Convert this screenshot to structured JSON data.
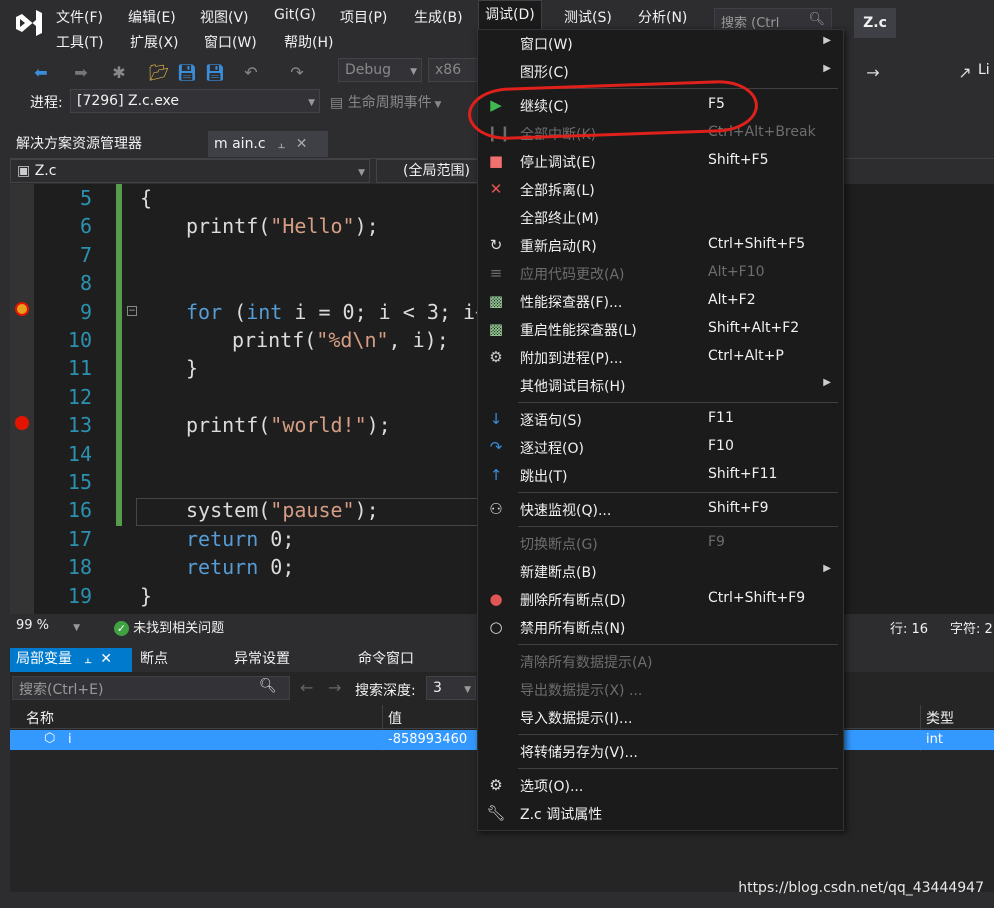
{
  "menubar": {
    "row1": [
      "文件(F)",
      "编辑(E)",
      "视图(V)",
      "Git(G)",
      "项目(P)",
      "生成(B)",
      "调试(D)",
      "测试(S)",
      "分析(N)"
    ],
    "row2": [
      "工具(T)",
      "扩展(X)",
      "窗口(W)",
      "帮助(H)"
    ],
    "search_placeholder": "搜索 (Ctrl",
    "solution_badge": "Z.c"
  },
  "toolbar": {
    "config": "Debug",
    "platform": "x86",
    "right_label": "Li"
  },
  "process_bar": {
    "label": "进程:",
    "process": "[7296] Z.c.exe",
    "lifecycle": "生命周期事件"
  },
  "tabs": {
    "solution_explorer": "解决方案资源管理器",
    "file_tab_prefix": "m",
    "file_tab": "ain.c"
  },
  "navbar": {
    "file": "Z.c",
    "scope": "(全局范围)"
  },
  "editor": {
    "lines": [
      {
        "num": "5",
        "code": "{"
      },
      {
        "num": "6",
        "code": "printf(\"Hello\");"
      },
      {
        "num": "7",
        "code": ""
      },
      {
        "num": "8",
        "code": ""
      },
      {
        "num": "9",
        "code": "for (int i = 0; i < 3; i+"
      },
      {
        "num": "10",
        "code": "printf(\"%d\\n\", i);"
      },
      {
        "num": "11",
        "code": "}"
      },
      {
        "num": "12",
        "code": ""
      },
      {
        "num": "13",
        "code": "printf(\"world!\");"
      },
      {
        "num": "14",
        "code": ""
      },
      {
        "num": "15",
        "code": ""
      },
      {
        "num": "16",
        "code": "system(\"pause\");"
      },
      {
        "num": "17",
        "code": "return 0;"
      },
      {
        "num": "18",
        "code": "return 0;"
      },
      {
        "num": "19",
        "code": "}"
      }
    ]
  },
  "editor_status": {
    "zoom": "99 %",
    "issues": "未找到相关问题",
    "line": "行: 16",
    "char": "字符: 2"
  },
  "bottom_panel": {
    "tabs": [
      "局部变量",
      "断点",
      "异常设置",
      "命令窗口"
    ],
    "search_placeholder": "搜索(Ctrl+E)",
    "depth_label": "搜索深度:",
    "depth_value": "3",
    "columns": {
      "name": "名称",
      "value": "值",
      "type": "类型"
    },
    "row": {
      "name": "i",
      "value": "-858993460",
      "type": "int"
    }
  },
  "debug_menu": {
    "items": [
      {
        "label": "窗口(W)",
        "shortcut": "",
        "icon": "none",
        "submenu": true,
        "disabled": false
      },
      {
        "label": "图形(C)",
        "shortcut": "",
        "icon": "none",
        "submenu": true,
        "disabled": false
      },
      {
        "label": "继续(C)",
        "shortcut": "F5",
        "icon": "play-icon",
        "submenu": false,
        "disabled": false
      },
      {
        "label": "全部中断(K)",
        "shortcut": "Ctrl+Alt+Break",
        "icon": "pause-icon",
        "submenu": false,
        "disabled": true
      },
      {
        "label": "停止调试(E)",
        "shortcut": "Shift+F5",
        "icon": "stop-icon",
        "submenu": false,
        "disabled": false
      },
      {
        "label": "全部拆离(L)",
        "shortcut": "",
        "icon": "x-icon",
        "submenu": false,
        "disabled": false
      },
      {
        "label": "全部终止(M)",
        "shortcut": "",
        "icon": "none",
        "submenu": false,
        "disabled": false
      },
      {
        "label": "重新启动(R)",
        "shortcut": "Ctrl+Shift+F5",
        "icon": "restart-icon",
        "submenu": false,
        "disabled": false
      },
      {
        "label": "应用代码更改(A)",
        "shortcut": "Alt+F10",
        "icon": "apply-code-icon",
        "submenu": false,
        "disabled": true
      },
      {
        "label": "性能探查器(F)...",
        "shortcut": "Alt+F2",
        "icon": "profiler-icon",
        "submenu": false,
        "disabled": false
      },
      {
        "label": "重启性能探查器(L)",
        "shortcut": "Shift+Alt+F2",
        "icon": "profiler-icon",
        "submenu": false,
        "disabled": false
      },
      {
        "label": "附加到进程(P)...",
        "shortcut": "Ctrl+Alt+P",
        "icon": "attach-icon",
        "submenu": false,
        "disabled": false
      },
      {
        "label": "其他调试目标(H)",
        "shortcut": "",
        "icon": "none",
        "submenu": true,
        "disabled": false
      },
      {
        "label": "逐语句(S)",
        "shortcut": "F11",
        "icon": "step-into-icon",
        "submenu": false,
        "disabled": false
      },
      {
        "label": "逐过程(O)",
        "shortcut": "F10",
        "icon": "step-over-icon",
        "submenu": false,
        "disabled": false
      },
      {
        "label": "跳出(T)",
        "shortcut": "Shift+F11",
        "icon": "step-out-icon",
        "submenu": false,
        "disabled": false
      },
      {
        "label": "快速监视(Q)...",
        "shortcut": "Shift+F9",
        "icon": "quickwatch-icon",
        "submenu": false,
        "disabled": false
      },
      {
        "label": "切换断点(G)",
        "shortcut": "F9",
        "icon": "none",
        "submenu": false,
        "disabled": true
      },
      {
        "label": "新建断点(B)",
        "shortcut": "",
        "icon": "none",
        "submenu": true,
        "disabled": false
      },
      {
        "label": "删除所有断点(D)",
        "shortcut": "Ctrl+Shift+F9",
        "icon": "delete-breakpoints-icon",
        "submenu": false,
        "disabled": false
      },
      {
        "label": "禁用所有断点(N)",
        "shortcut": "",
        "icon": "disable-breakpoints-icon",
        "submenu": false,
        "disabled": false
      },
      {
        "label": "清除所有数据提示(A)",
        "shortcut": "",
        "icon": "none",
        "submenu": false,
        "disabled": true
      },
      {
        "label": "导出数据提示(X) ...",
        "shortcut": "",
        "icon": "none",
        "submenu": false,
        "disabled": true
      },
      {
        "label": "导入数据提示(I)...",
        "shortcut": "",
        "icon": "none",
        "submenu": false,
        "disabled": false
      },
      {
        "label": "将转储另存为(V)...",
        "shortcut": "",
        "icon": "none",
        "submenu": false,
        "disabled": false
      },
      {
        "label": "选项(O)...",
        "shortcut": "",
        "icon": "gear-icon",
        "submenu": false,
        "disabled": false
      },
      {
        "label": "Z.c 调试属性",
        "shortcut": "",
        "icon": "wrench-icon",
        "submenu": false,
        "disabled": false
      }
    ]
  },
  "watermark": "https://blog.csdn.net/qq_43444947",
  "colors": {
    "accent": "#3399ff",
    "annotation_circle": "#e0201a",
    "breakpoint": "#e51400",
    "keyword": "#569cd6",
    "string": "#d69d85",
    "line_number": "#2b91af"
  }
}
